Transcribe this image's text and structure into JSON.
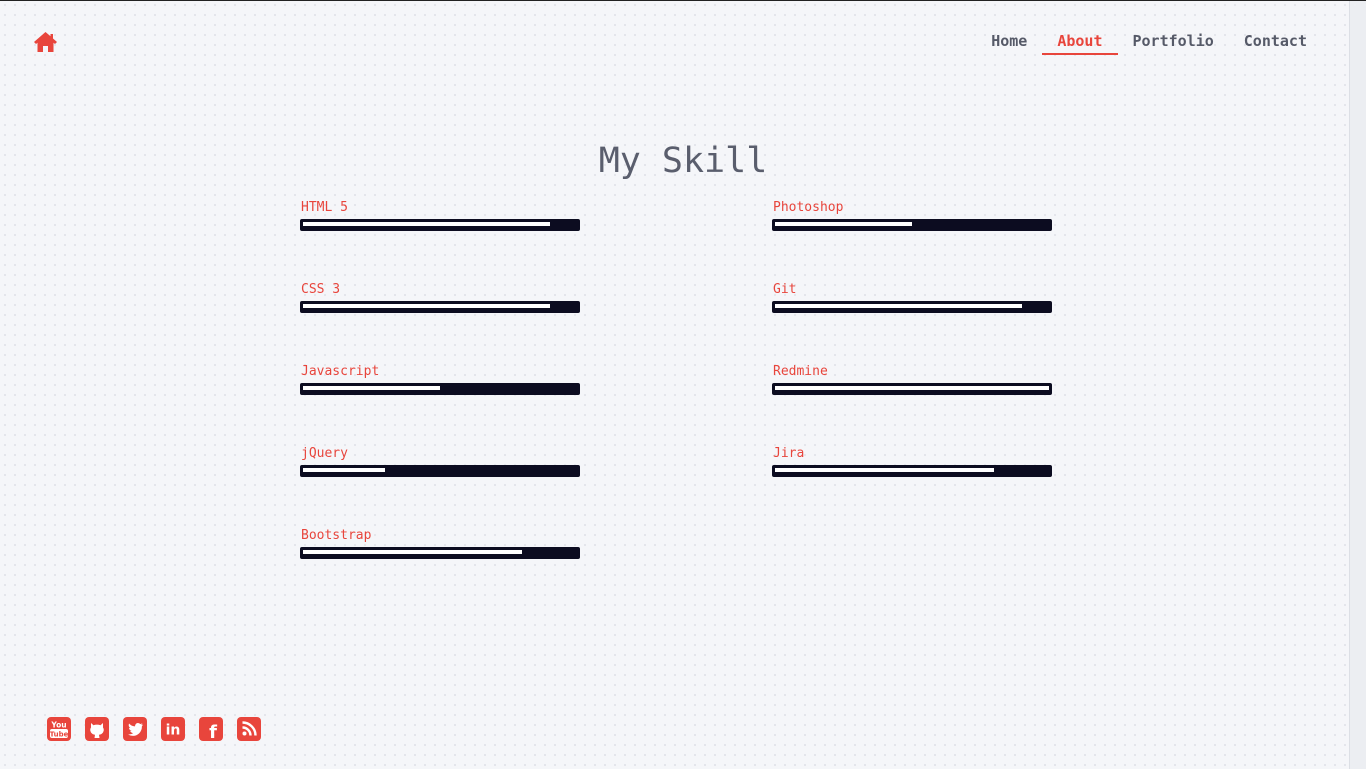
{
  "nav": {
    "home_icon": "home-icon",
    "items": [
      {
        "label": "Home",
        "active": false
      },
      {
        "label": "About",
        "active": true
      },
      {
        "label": "Portfolio",
        "active": false
      },
      {
        "label": "Contact",
        "active": false
      }
    ]
  },
  "title": "My Skill",
  "skills": [
    {
      "name": "HTML 5",
      "level": 0.9
    },
    {
      "name": "CSS 3",
      "level": 0.9
    },
    {
      "name": "Javascript",
      "level": 0.5
    },
    {
      "name": "jQuery",
      "level": 0.3
    },
    {
      "name": "Bootstrap",
      "level": 0.8
    },
    {
      "name": "Photoshop",
      "level": 0.5
    },
    {
      "name": "Git",
      "level": 0.9
    },
    {
      "name": "Redmine",
      "level": 1.0
    },
    {
      "name": "Jira",
      "level": 0.8
    }
  ],
  "social": [
    "youtube-icon",
    "github-icon",
    "twitter-icon",
    "linkedin-icon",
    "facebook-icon",
    "rss-icon"
  ],
  "social_text": {
    "youtube_top": "You",
    "youtube_bottom": "Tube",
    "linkedin": "in",
    "facebook": "f"
  },
  "colors": {
    "accent": "#e8453c",
    "track": "#0c0c20",
    "fill": "#ffffff",
    "text": "#565a68"
  }
}
